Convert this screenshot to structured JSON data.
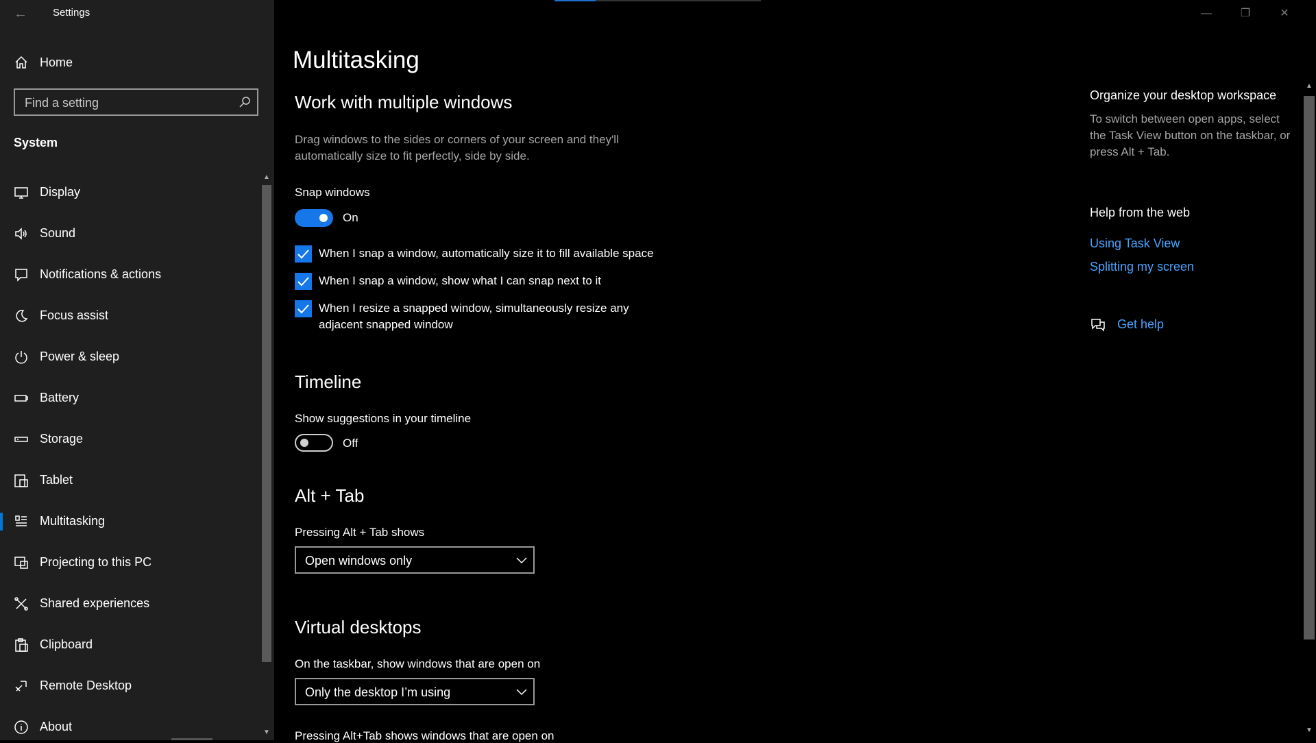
{
  "window": {
    "title": "Settings"
  },
  "sidebar": {
    "home": "Home",
    "search_placeholder": "Find a setting",
    "section": "System",
    "items": [
      {
        "label": "Display",
        "icon": "monitor-icon"
      },
      {
        "label": "Sound",
        "icon": "speaker-icon"
      },
      {
        "label": "Notifications & actions",
        "icon": "notification-icon"
      },
      {
        "label": "Focus assist",
        "icon": "moon-icon"
      },
      {
        "label": "Power & sleep",
        "icon": "power-icon"
      },
      {
        "label": "Battery",
        "icon": "battery-icon"
      },
      {
        "label": "Storage",
        "icon": "storage-icon"
      },
      {
        "label": "Tablet",
        "icon": "tablet-icon"
      },
      {
        "label": "Multitasking",
        "icon": "multitasking-icon",
        "selected": true
      },
      {
        "label": "Projecting to this PC",
        "icon": "projector-icon"
      },
      {
        "label": "Shared experiences",
        "icon": "shared-icon"
      },
      {
        "label": "Clipboard",
        "icon": "clipboard-icon"
      },
      {
        "label": "Remote Desktop",
        "icon": "remote-desktop-icon"
      },
      {
        "label": "About",
        "icon": "info-icon"
      }
    ]
  },
  "main": {
    "title": "Multitasking",
    "multiwin": {
      "heading": "Work with multiple windows",
      "description": "Drag windows to the sides or corners of your screen and they'll automatically size to fit perfectly, side by side.",
      "snap_label": "Snap windows",
      "snap_state": "On",
      "checkboxes": [
        "When I snap a window, automatically size it to fill available space",
        "When I snap a window, show what I can snap next to it",
        "When I resize a snapped window, simultaneously resize any adjacent snapped window"
      ]
    },
    "timeline": {
      "heading": "Timeline",
      "label": "Show suggestions in your timeline",
      "state": "Off"
    },
    "alttab": {
      "heading": "Alt + Tab",
      "label": "Pressing Alt + Tab shows",
      "value": "Open windows only"
    },
    "virtual": {
      "heading": "Virtual desktops",
      "label": "On the taskbar, show windows that are open on",
      "value": "Only the desktop I’m using",
      "cut_label": "Pressing Alt+Tab shows windows that are open on"
    }
  },
  "right": {
    "organize_title": "Organize your desktop workspace",
    "organize_text": "To switch between open apps, select the Task View button on the taskbar, or press Alt + Tab.",
    "help_title": "Help from the web",
    "links": [
      "Using Task View",
      "Splitting my screen"
    ],
    "get_help": "Get help"
  },
  "colors": {
    "accent": "#1677e8",
    "link": "#4aa3ff",
    "sidebar_bg": "#1f1f1f",
    "main_bg": "#000000"
  }
}
